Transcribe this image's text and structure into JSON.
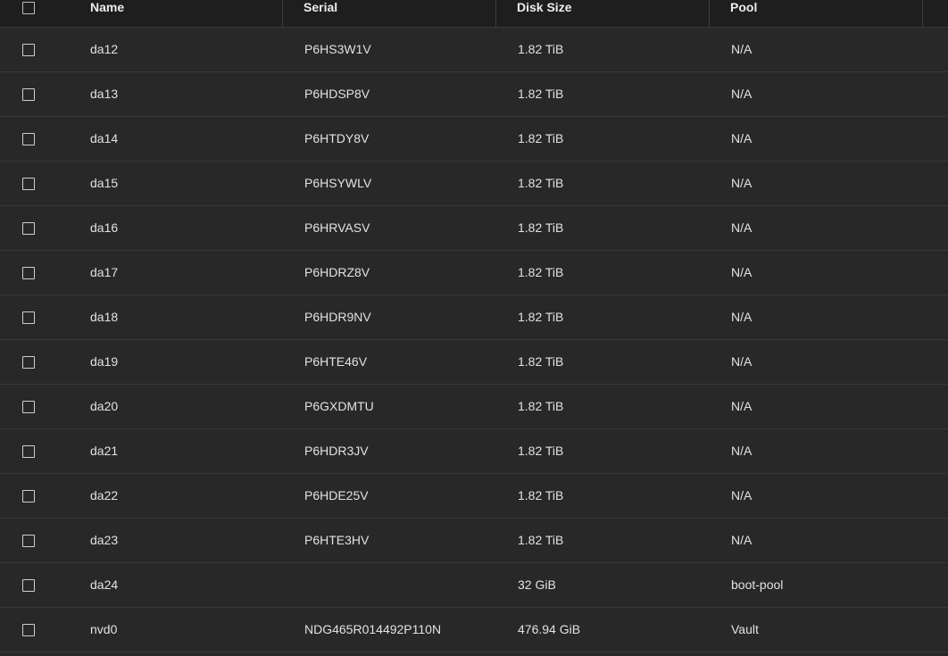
{
  "table": {
    "columns": {
      "name": "Name",
      "serial": "Serial",
      "disk_size": "Disk Size",
      "pool": "Pool"
    },
    "rows": [
      {
        "name": "da12",
        "serial": "P6HS3W1V",
        "disk_size": "1.82 TiB",
        "pool": "N/A"
      },
      {
        "name": "da13",
        "serial": "P6HDSP8V",
        "disk_size": "1.82 TiB",
        "pool": "N/A"
      },
      {
        "name": "da14",
        "serial": "P6HTDY8V",
        "disk_size": "1.82 TiB",
        "pool": "N/A"
      },
      {
        "name": "da15",
        "serial": "P6HSYWLV",
        "disk_size": "1.82 TiB",
        "pool": "N/A"
      },
      {
        "name": "da16",
        "serial": "P6HRVASV",
        "disk_size": "1.82 TiB",
        "pool": "N/A"
      },
      {
        "name": "da17",
        "serial": "P6HDRZ8V",
        "disk_size": "1.82 TiB",
        "pool": "N/A"
      },
      {
        "name": "da18",
        "serial": "P6HDR9NV",
        "disk_size": "1.82 TiB",
        "pool": "N/A"
      },
      {
        "name": "da19",
        "serial": "P6HTE46V",
        "disk_size": "1.82 TiB",
        "pool": "N/A"
      },
      {
        "name": "da20",
        "serial": "P6GXDMTU",
        "disk_size": "1.82 TiB",
        "pool": "N/A"
      },
      {
        "name": "da21",
        "serial": "P6HDR3JV",
        "disk_size": "1.82 TiB",
        "pool": "N/A"
      },
      {
        "name": "da22",
        "serial": "P6HDE25V",
        "disk_size": "1.82 TiB",
        "pool": "N/A"
      },
      {
        "name": "da23",
        "serial": "P6HTE3HV",
        "disk_size": "1.82 TiB",
        "pool": "N/A"
      },
      {
        "name": "da24",
        "serial": "",
        "disk_size": "32 GiB",
        "pool": "boot-pool"
      },
      {
        "name": "nvd0",
        "serial": "NDG465R014492P110N",
        "disk_size": "476.94 GiB",
        "pool": "Vault"
      }
    ]
  }
}
